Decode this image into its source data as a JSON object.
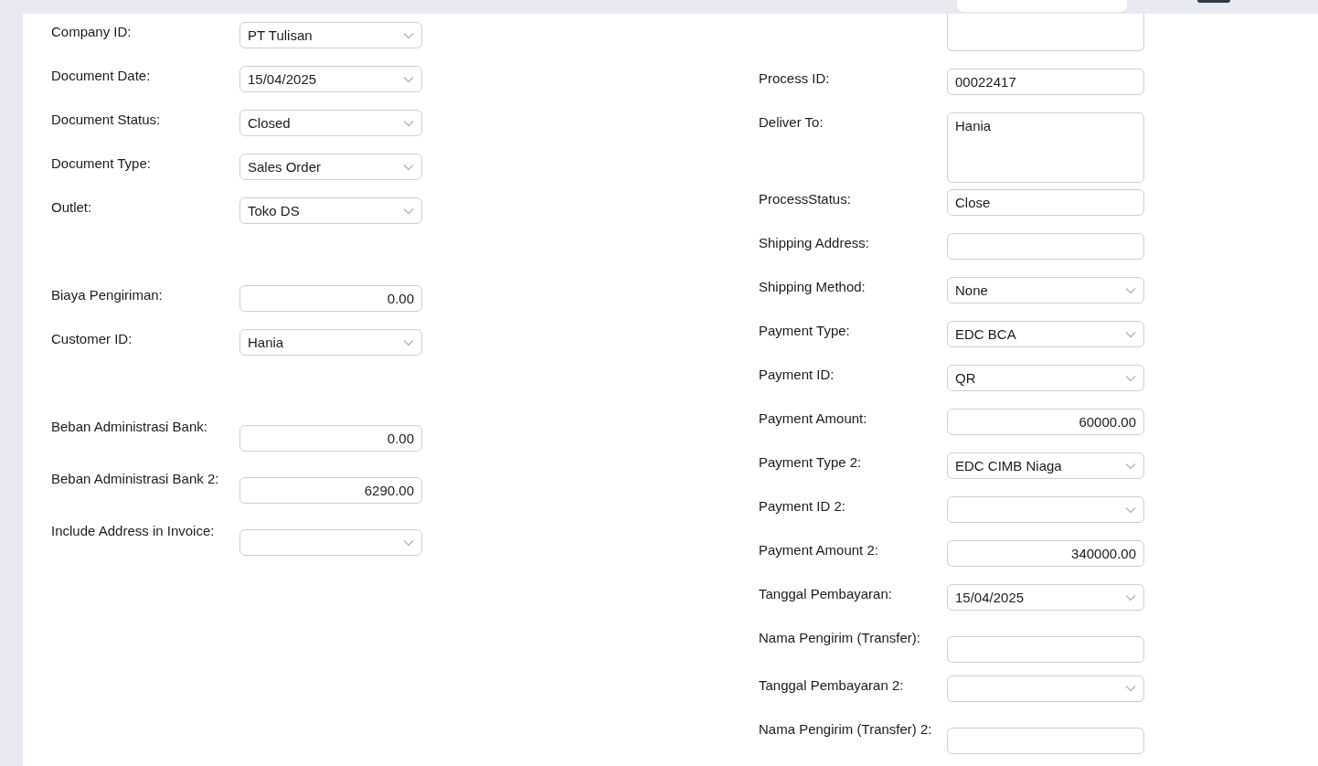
{
  "left_fields": [
    {
      "label": "Company ID:",
      "kind": "select",
      "value": "PT Tulisan"
    },
    {
      "label": "Document Date:",
      "kind": "select",
      "value": "15/04/2025"
    },
    {
      "label": "Document Status:",
      "kind": "select",
      "value": "Closed"
    },
    {
      "label": "Document Type:",
      "kind": "select",
      "value": "Sales Order"
    },
    {
      "label": "Outlet:",
      "kind": "select",
      "value": "Toko DS"
    },
    {
      "kind": "spacer"
    },
    {
      "label": "Biaya Pengiriman:",
      "kind": "number",
      "value": "0.00"
    },
    {
      "label": "Customer ID:",
      "kind": "select",
      "value": "Hania"
    },
    {
      "kind": "spacer"
    },
    {
      "label": "Beban Administrasi Bank:",
      "kind": "number",
      "value": "0.00"
    },
    {
      "label": "Beban Administrasi Bank 2:",
      "kind": "number",
      "value": "6290.00"
    },
    {
      "label": "Include Address in Invoice:",
      "kind": "select"
    }
  ],
  "right_fields": [
    {
      "kind": "clipped-textarea"
    },
    {
      "label": "Process ID:",
      "kind": "text",
      "value": "00022417"
    },
    {
      "label": "Deliver To:",
      "kind": "textarea",
      "value": "Hania"
    },
    {
      "label": "ProcessStatus:",
      "kind": "text",
      "value": "Close"
    },
    {
      "label": "Shipping Address:",
      "kind": "text"
    },
    {
      "label": "Shipping Method:",
      "kind": "select",
      "value": "None"
    },
    {
      "label": "Payment Type:",
      "kind": "select",
      "value": "EDC BCA"
    },
    {
      "label": "Payment ID:",
      "kind": "select",
      "value": "QR"
    },
    {
      "label": "Payment Amount:",
      "kind": "number",
      "value": "60000.00"
    },
    {
      "label": "Payment Type 2:",
      "kind": "select",
      "value": "EDC CIMB Niaga"
    },
    {
      "label": "Payment ID 2:",
      "kind": "select"
    },
    {
      "label": "Payment Amount 2:",
      "kind": "number",
      "value": "340000.00"
    },
    {
      "label": "Tanggal Pembayaran:",
      "kind": "select",
      "value": "15/04/2025"
    },
    {
      "label": "Nama Pengirim (Transfer):",
      "kind": "text"
    },
    {
      "label": "Tanggal Pembayaran 2:",
      "kind": "select"
    },
    {
      "label": "Nama Pengirim (Transfer) 2:",
      "kind": "text"
    }
  ]
}
